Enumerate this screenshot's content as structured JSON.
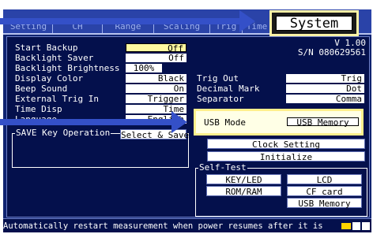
{
  "tabs": [
    "Setting",
    "CH",
    "Range",
    "Scaling",
    "Trig",
    "Time",
    "System"
  ],
  "version": "V 1.00",
  "serial": "S/N 080629561",
  "left_settings": [
    {
      "label": "Start Backup",
      "value": "Off"
    },
    {
      "label": "Backlight Saver",
      "value": "Off"
    },
    {
      "label": "Backlight Brightness",
      "value": "100%"
    },
    {
      "label": "Display Color",
      "value": "Black"
    },
    {
      "label": "Beep Sound",
      "value": "On"
    },
    {
      "label": "External Trig In",
      "value": "Trigger"
    },
    {
      "label": "Time Disp",
      "value": "Time"
    },
    {
      "label": "Language",
      "value": "English"
    }
  ],
  "right_settings": [
    {
      "label": "Trig Out",
      "value": "Trig"
    },
    {
      "label": "Decimal Mark",
      "value": "Dot"
    },
    {
      "label": "Separator",
      "value": "Comma"
    }
  ],
  "usb": {
    "label": "USB Mode",
    "value": "USB Memory"
  },
  "clock_button": "Clock Setting",
  "initialize_button": "Initialize",
  "save_key": {
    "title": "SAVE Key Operation",
    "value": "Select & Save"
  },
  "self_test": {
    "title": "Self-Test",
    "buttons": [
      "KEY/LED",
      "LCD",
      "ROM/RAM",
      "CF card",
      "USB Memory"
    ]
  },
  "status_text": "Automatically restart measurement when power resumes after it is",
  "callout": {
    "system_label": "System"
  },
  "colors": {
    "screen_bg": "#04104c",
    "highlight": "#fff9a0",
    "arrow": "#3450c8",
    "callout_border": "#fff3a6"
  }
}
